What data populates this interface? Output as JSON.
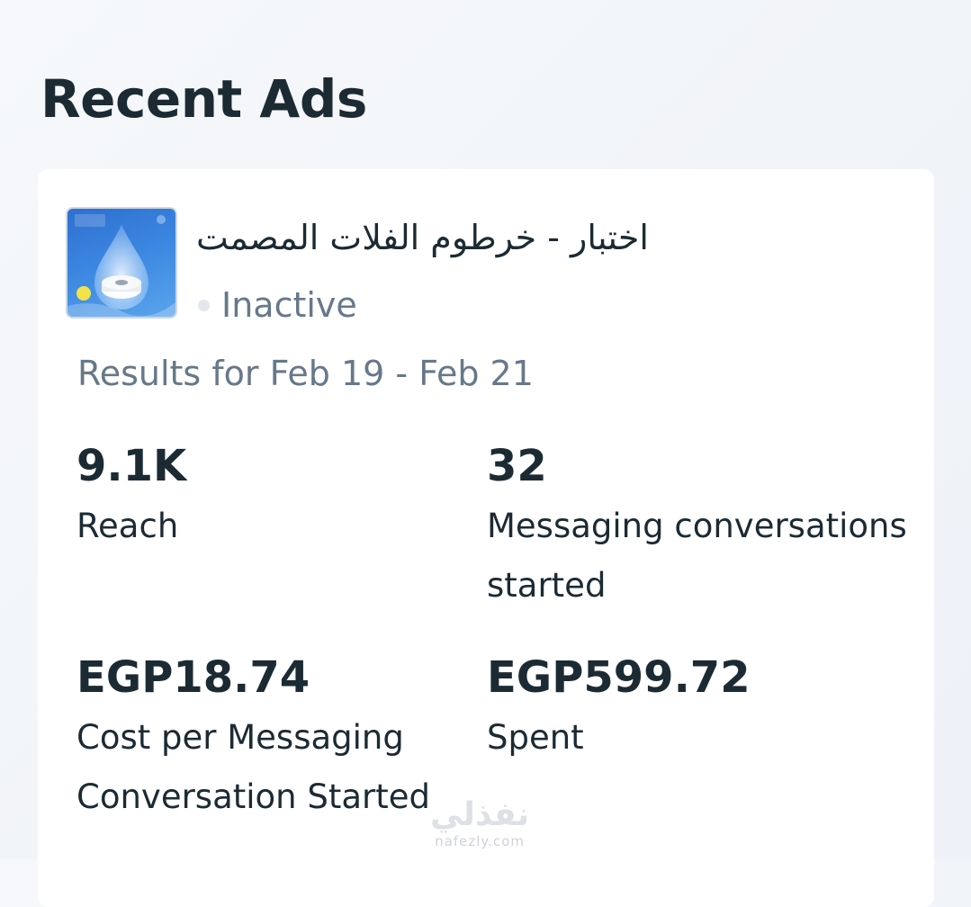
{
  "page": {
    "title": "Recent Ads"
  },
  "ad": {
    "name": "اختبار - خرطوم الفلات المصمت",
    "status": "Inactive",
    "results_range": "Results for Feb 19 - Feb 21",
    "thumbnail_icon": "water-drop-product-image"
  },
  "metrics": {
    "reach": {
      "value": "9.1K",
      "label": "Reach"
    },
    "messaging": {
      "value": "32",
      "label": "Messaging conversations started"
    },
    "cost_per_messaging": {
      "value": "EGP18.74",
      "label": "Cost per Messaging Conversation Started"
    },
    "spent": {
      "value": "EGP599.72",
      "label": "Spent"
    }
  },
  "watermark": {
    "logo": "نفذلي",
    "url": "nafezly.com"
  },
  "colors": {
    "text_primary": "#1c2b33",
    "text_secondary": "#67788a",
    "status_inactive": "#e4e7eb",
    "card_bg": "#ffffff"
  }
}
